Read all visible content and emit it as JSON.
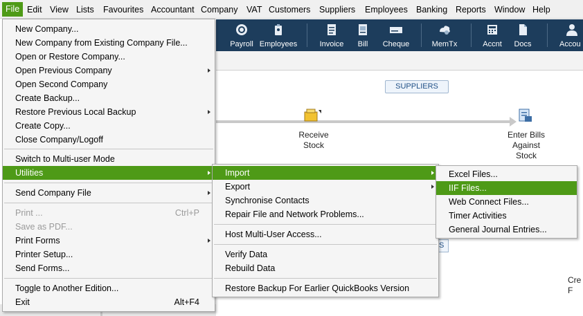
{
  "menubar": {
    "items": [
      "File",
      "Edit",
      "View",
      "Lists",
      "Favourites",
      "Accountant",
      "Company",
      "VAT",
      "Customers",
      "Suppliers",
      "Employees",
      "Banking",
      "Reports",
      "Window",
      "Help"
    ]
  },
  "iconbar": {
    "buttons": [
      "Payroll",
      "Employees",
      "Invoice",
      "Bill",
      "Cheque",
      "MemTx",
      "Accnt",
      "Docs",
      "Accou"
    ]
  },
  "workspace": {
    "suppliers_tag": "SUPPLIERS",
    "receive_stock": "Receive\nStock",
    "enter_bills": "Enter Bills\nAgainst\nStock",
    "partial_tag": "S",
    "partial_text": "Cre\nF"
  },
  "file_menu": {
    "items": [
      "New Company...",
      "New Company from Existing Company File...",
      "Open or Restore Company...",
      "Open Previous Company",
      "Open Second Company",
      "Create Backup...",
      "Restore Previous Local Backup",
      "Create Copy...",
      "Close Company/Logoff",
      "Switch to Multi-user Mode",
      "Utilities",
      "Send Company File",
      "Print ...",
      "Save as PDF...",
      "Print Forms",
      "Printer Setup...",
      "Send Forms...",
      "Toggle to Another Edition...",
      "Exit"
    ],
    "shortcut_print": "Ctrl+P",
    "shortcut_exit": "Alt+F4"
  },
  "utilities_menu": {
    "items": [
      "Import",
      "Export",
      "Synchronise Contacts",
      "Repair File and Network Problems...",
      "Host Multi-User Access...",
      "Verify Data",
      "Rebuild Data",
      "Restore Backup For Earlier QuickBooks Version"
    ]
  },
  "import_menu": {
    "items": [
      "Excel Files...",
      "IIF Files...",
      "Web Connect Files...",
      "Timer Activities",
      "General Journal Entries..."
    ]
  },
  "colors": {
    "highlight": "#4e9a17",
    "iconbar": "#1d3d5c"
  }
}
